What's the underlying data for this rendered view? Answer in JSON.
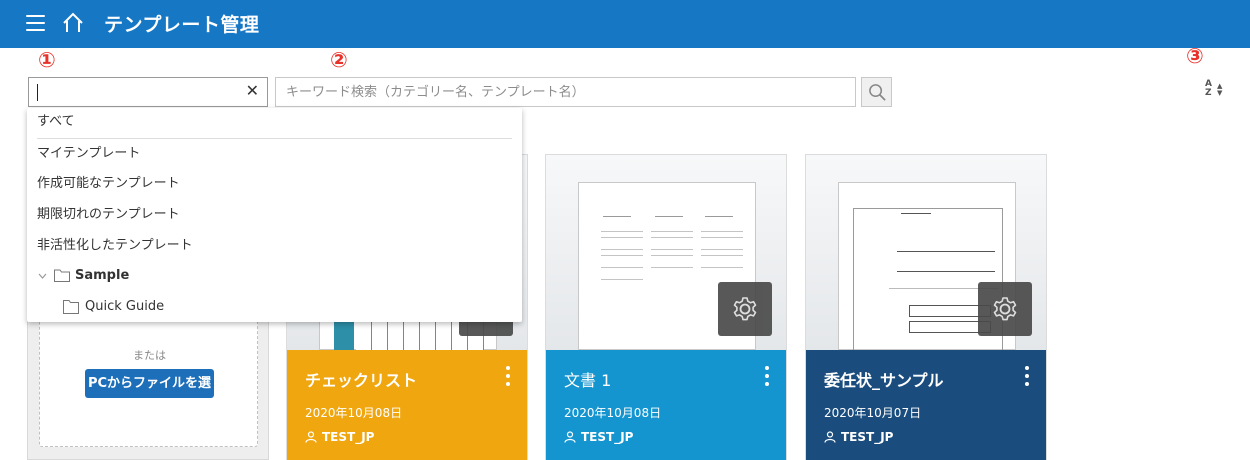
{
  "header": {
    "title": "テンプレート管理",
    "menu_icon": "menu-icon",
    "home_icon": "home-icon",
    "background": "#1677c4"
  },
  "markers": [
    "①",
    "②",
    "③"
  ],
  "category_select": {
    "value": "",
    "clear_label": "✕"
  },
  "search": {
    "placeholder": "キーワード検索（カテゴリー名、テンプレート名）",
    "icon": "search-icon"
  },
  "sort": {
    "icon": "sort-alpha-icon",
    "label_top": "A",
    "label_bottom": "Z",
    "arrow_up": "▲",
    "arrow_down": "▼"
  },
  "dropdown": {
    "all": "すべて",
    "items": [
      "マイテンプレート",
      "作成可能なテンプレート",
      "期限切れのテンプレート",
      "非活性化したテンプレート"
    ],
    "tree": {
      "folder": "Sample",
      "child": "Quick Guide"
    }
  },
  "upload": {
    "or_label": "または",
    "button_label": "PCからファイルを選択"
  },
  "cards": [
    {
      "name": "チェックリスト",
      "date": "2020年10月08日",
      "owner": "TEST_JP",
      "color": "#f0a60f"
    },
    {
      "name": "文書 1",
      "date": "2020年10月08日",
      "owner": "TEST_JP",
      "color": "#1495cf"
    },
    {
      "name": "委任状_サンプル",
      "date": "2020年10月07日",
      "owner": "TEST_JP",
      "color": "#1a4d7e"
    }
  ],
  "colors": {
    "marker": "#e8332a",
    "primary_button": "#1e6fba"
  }
}
